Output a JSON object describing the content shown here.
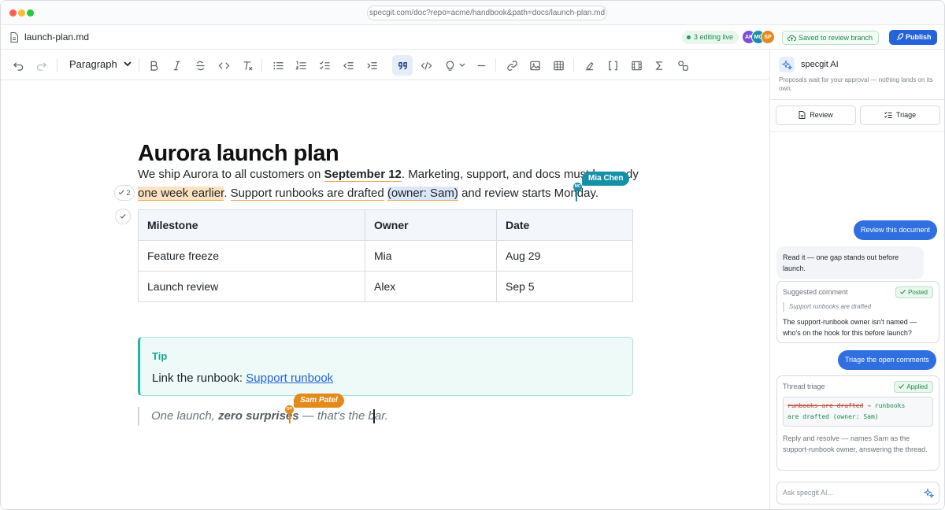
{
  "browser": {
    "url": "specgit.com/doc?repo=acme/handbook&path=docs/launch-plan.md"
  },
  "header": {
    "file_name": "launch-plan.md",
    "editing_live": "3 editing live",
    "avatars": [
      {
        "initials": "AK",
        "color": "#7c4dde"
      },
      {
        "initials": "MC",
        "color": "#1590a8"
      },
      {
        "initials": "SP",
        "color": "#e48a1b"
      }
    ],
    "saved_label": "Saved to review branch",
    "publish_label": "Publish"
  },
  "toolbar": {
    "block_type": "Paragraph",
    "icons": [
      "undo-icon",
      "redo-icon",
      "bold-icon",
      "italic-icon",
      "strikethrough-icon",
      "inline-code-icon",
      "clear-format-icon",
      "bullet-list-icon",
      "numbered-list-icon",
      "task-list-icon",
      "outdent-icon",
      "indent-icon",
      "blockquote-icon",
      "code-block-icon",
      "callout-icon",
      "horizontal-rule-icon",
      "link-icon",
      "image-icon",
      "table-icon",
      "highlight-icon",
      "brackets-icon",
      "video-icon",
      "sigma-icon",
      "shapes-icon"
    ],
    "active": "blockquote-icon"
  },
  "document": {
    "title": "Aurora launch plan",
    "para1": {
      "a": "We ship Aurora to all customers on ",
      "b": "September 12",
      "c": ". Marketing, support, and docs must be ready"
    },
    "para2": {
      "a": "one week earlier",
      "b": ". ",
      "c": "Support runbooks are drafted",
      "d": " ",
      "e": "(owner: Sam)",
      "f": " and review starts Monday."
    },
    "comment_count": "2",
    "table": {
      "headers": [
        "Milestone",
        "Owner",
        "Date"
      ],
      "rows": [
        [
          "Feature freeze",
          "Mia",
          "Aug 29"
        ],
        [
          "Launch review",
          "Alex",
          "Sep 5"
        ]
      ]
    },
    "tip": {
      "title": "Tip",
      "text": "Link the runbook: ",
      "link": "Support runbook"
    },
    "quote": {
      "a": "One launch, ",
      "b": "zero surprises",
      "c": " — that's the bar."
    }
  },
  "collaborators": {
    "mia": {
      "name": "Mia Chen",
      "initials": "MC",
      "color": "#1590a8"
    },
    "sam": {
      "name": "Sam Patel",
      "initials": "SP",
      "color": "#e48a1b"
    }
  },
  "assistant": {
    "title": "specgit AI",
    "subtitle": "Proposals wait for your approval — nothing lands on its own.",
    "tabs": {
      "review": "Review",
      "triage": "Triage"
    },
    "messages": {
      "user1": "Review this document",
      "ai1": "Read it — one gap stands out before launch.",
      "card1": {
        "label": "Suggested comment",
        "status": "Posted",
        "quote": "Support runbooks are drafted",
        "text": "The support-runbook owner isn't named — who's on the hook for this before launch?"
      },
      "user2": "Triage the open comments",
      "card2": {
        "label": "Thread triage",
        "status": "Applied",
        "diff_old": "runbooks are drafted",
        "diff_arrow": " → ",
        "diff_new_1": "runbooks",
        "diff_new_2": "are drafted (owner: Sam)",
        "text": "Reply and resolve — names Sam as the support-runbook owner, answering the thread."
      }
    },
    "input_placeholder": "Ask specgit AI..."
  }
}
